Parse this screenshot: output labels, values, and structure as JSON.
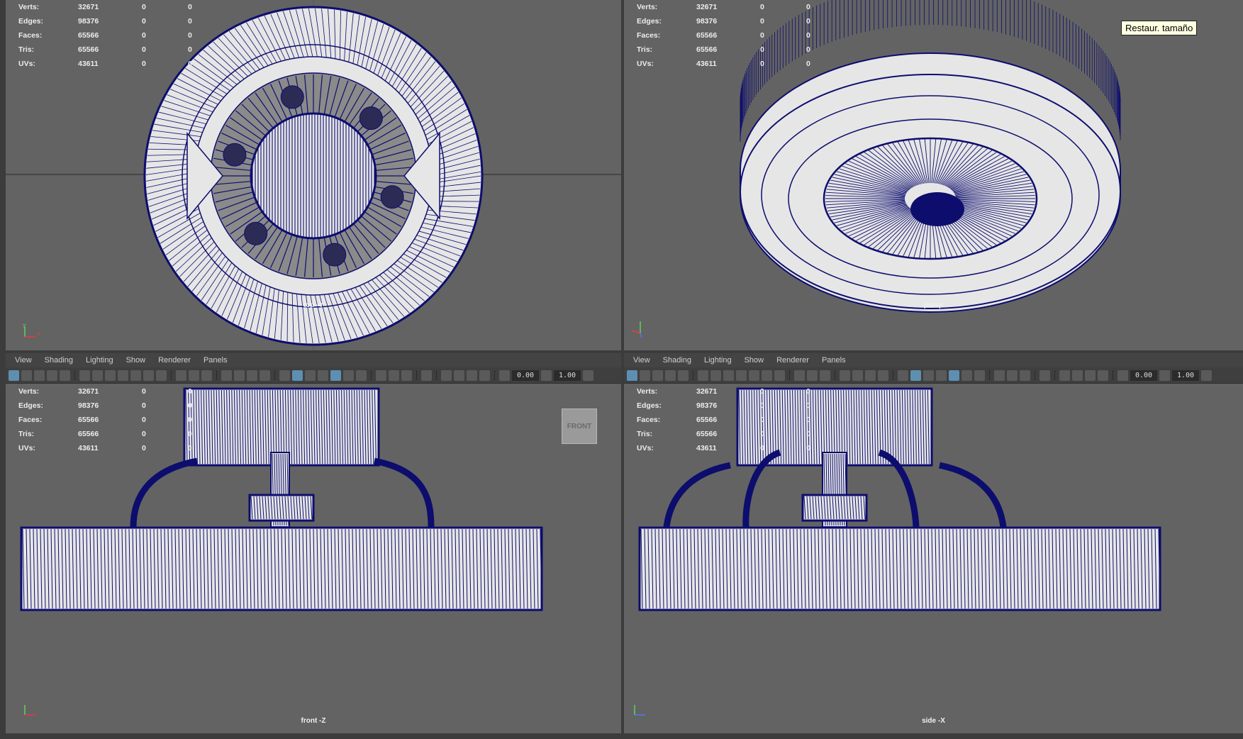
{
  "stats": [
    {
      "label": "Verts:",
      "value": "32671",
      "sel": "0",
      "comp": "0"
    },
    {
      "label": "Edges:",
      "value": "98376",
      "sel": "0",
      "comp": "0"
    },
    {
      "label": "Faces:",
      "value": "65566",
      "sel": "0",
      "comp": "0"
    },
    {
      "label": "Tris:",
      "value": "65566",
      "sel": "0",
      "comp": "0"
    },
    {
      "label": "UVs:",
      "value": "43611",
      "sel": "0",
      "comp": "0"
    }
  ],
  "viewports": {
    "top": {
      "camera": "top -Y"
    },
    "persp": {
      "camera": "persp"
    },
    "front": {
      "camera": "front -Z"
    },
    "side": {
      "camera": "side -X"
    }
  },
  "menu": {
    "view": "View",
    "shading": "Shading",
    "lighting": "Lighting",
    "show": "Show",
    "renderer": "Renderer",
    "panels": "Panels"
  },
  "toolbar": {
    "field1": "0.00",
    "field2": "1.00"
  },
  "viewcube": "FRONT",
  "tooltip": "Restaur. tamaño",
  "colors": {
    "wire": "#0d0d6e",
    "mesh": "#e6e6e6",
    "background": "#636363",
    "active_icon": "#5d8fb0"
  },
  "icons": [
    "select-camera-icon",
    "camera-icon",
    "bookmark-icon",
    "grid-icon",
    "wireframe-icon",
    "smooth-shade-icon",
    "xray-icon",
    "lights-icon",
    "shadows-icon",
    "isolate-icon",
    "exposure-icon",
    "gamma-icon",
    "color-management-icon"
  ]
}
